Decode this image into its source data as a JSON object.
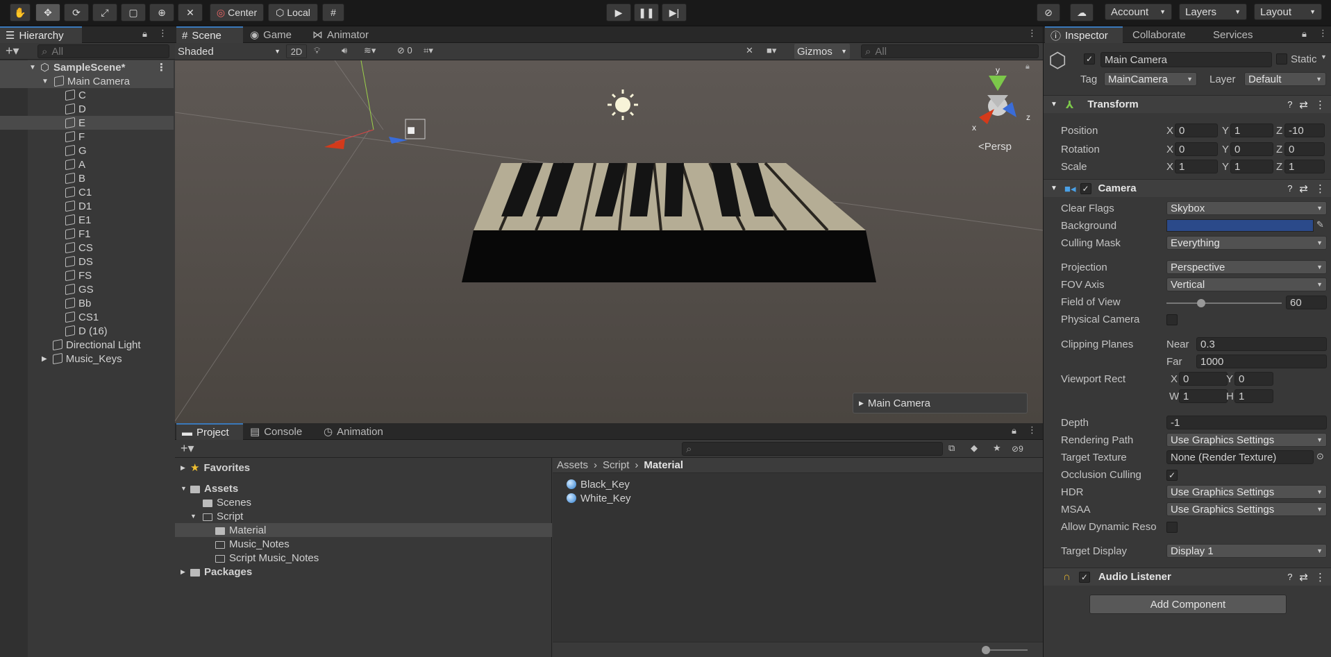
{
  "toolbar": {
    "pivot_label": "Center",
    "space_label": "Local",
    "account_label": "Account",
    "layers_label": "Layers",
    "layout_label": "Layout"
  },
  "hierarchy": {
    "tab_label": "Hierarchy",
    "search_placeholder": "All",
    "scene_name": "SampleScene*",
    "main_camera": "Main Camera",
    "children": [
      "C",
      "D",
      "E",
      "F",
      "G",
      "A",
      "B",
      "C1",
      "D1",
      "E1",
      "F1",
      "CS",
      "DS",
      "FS",
      "GS",
      "Bb",
      "CS1",
      "D (16)"
    ],
    "siblings": [
      "Directional Light",
      "Music_Keys"
    ]
  },
  "scene_view": {
    "tabs": [
      "Scene",
      "Game",
      "Animator"
    ],
    "shading_mode": "Shaded",
    "mode_2d": "2D",
    "hidden_count": "0",
    "gizmos_label": "Gizmos",
    "search_placeholder": "All",
    "persp_label": "Persp",
    "axis_x": "x",
    "axis_y": "y",
    "axis_z": "z",
    "camera_preview_label": "Main Camera"
  },
  "project": {
    "tabs": [
      "Project",
      "Console",
      "Animation"
    ],
    "hidden_count": "9",
    "tree": [
      "Favorites",
      "Assets",
      "Scenes",
      "Script",
      "Material",
      "Music_Notes",
      "Script Music_Notes",
      "Packages"
    ],
    "breadcrumb": [
      "Assets",
      "Script",
      "Material"
    ],
    "files": [
      "Black_Key",
      "White_Key"
    ]
  },
  "inspector": {
    "tabs": [
      "Inspector",
      "Collaborate",
      "Services"
    ],
    "object_name": "Main Camera",
    "static_label": "Static",
    "tag_label": "Tag",
    "tag_value": "MainCamera",
    "layer_label": "Layer",
    "layer_value": "Default",
    "transform": {
      "title": "Transform",
      "position_label": "Position",
      "rotation_label": "Rotation",
      "scale_label": "Scale",
      "position": [
        "0",
        "1",
        "-10"
      ],
      "rotation": [
        "0",
        "0",
        "0"
      ],
      "scale": [
        "1",
        "1",
        "1"
      ]
    },
    "camera": {
      "title": "Camera",
      "clear_flags_label": "Clear Flags",
      "clear_flags": "Skybox",
      "background_label": "Background",
      "background_color": "#2b4a8a",
      "culling_mask_label": "Culling Mask",
      "culling_mask": "Everything",
      "projection_label": "Projection",
      "projection": "Perspective",
      "fov_axis_label": "FOV Axis",
      "fov_axis": "Vertical",
      "fov_label": "Field of View",
      "fov": "60",
      "fov_slider_fraction": 0.3,
      "physical_label": "Physical Camera",
      "clipping_label": "Clipping Planes",
      "near_label": "Near",
      "near": "0.3",
      "far_label": "Far",
      "far": "1000",
      "viewport_label": "Viewport Rect",
      "vx": "0",
      "vy": "0",
      "vw": "1",
      "vh": "1",
      "depth_label": "Depth",
      "depth": "-1",
      "rendering_path_label": "Rendering Path",
      "rendering_path": "Use Graphics Settings",
      "target_texture_label": "Target Texture",
      "target_texture": "None (Render Texture)",
      "occlusion_label": "Occlusion Culling",
      "hdr_label": "HDR",
      "hdr": "Use Graphics Settings",
      "msaa_label": "MSAA",
      "msaa": "Use Graphics Settings",
      "dynamic_res_label": "Allow Dynamic Reso",
      "target_display_label": "Target Display",
      "target_display": "Display 1"
    },
    "audio_listener": "Audio Listener",
    "add_component": "Add Component"
  }
}
